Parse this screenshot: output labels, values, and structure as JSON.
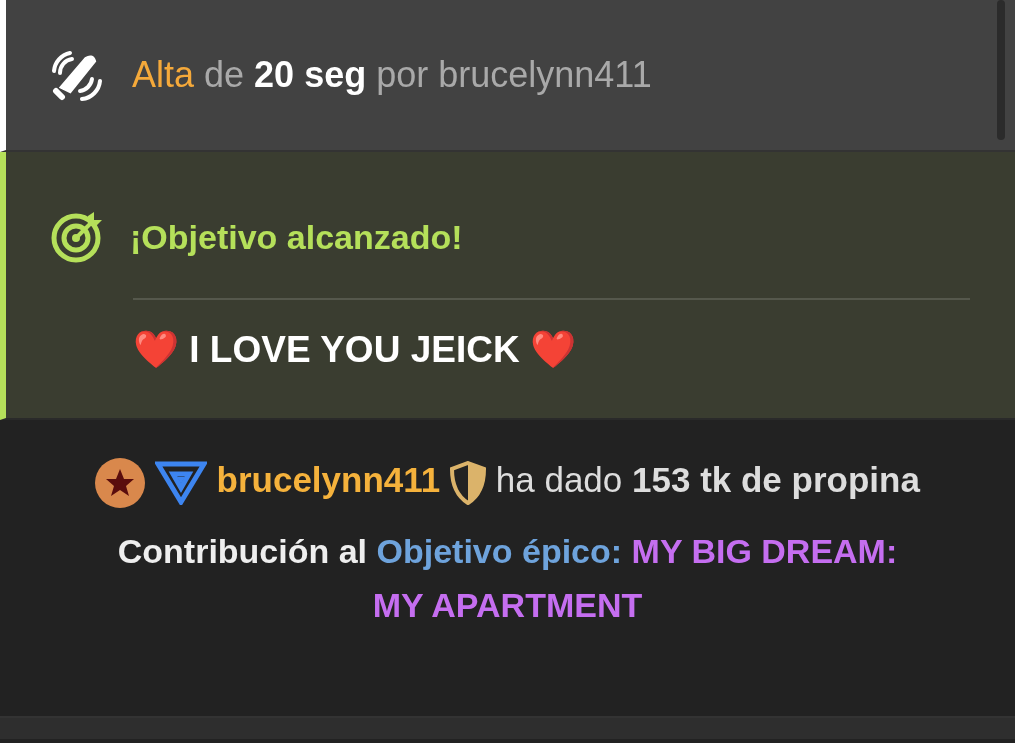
{
  "messages": [
    {
      "kind": "status",
      "segments": [
        {
          "text": "Alta",
          "kind": "accent"
        },
        {
          "text": " de ",
          "kind": "muted"
        },
        {
          "text": "20 seg",
          "kind": "strong"
        },
        {
          "text": " por brucelynn411",
          "kind": "muted"
        }
      ]
    },
    {
      "kind": "goal",
      "title": "¡Objetivo alcanzado!",
      "body": "❤️ I LOVE YOU JEICK ❤️"
    },
    {
      "kind": "tip",
      "username": "brucelynn411",
      "text": "ha dado **153 tk de propina**",
      "segments": [
        {
          "text": "Contribución al ",
          "kind": "plain"
        },
        {
          "text": "Objetivo épico:",
          "kind": "link"
        },
        {
          "text": " MY BIG DREAM: MY APARTMENT",
          "kind": "goal"
        }
      ]
    }
  ]
}
